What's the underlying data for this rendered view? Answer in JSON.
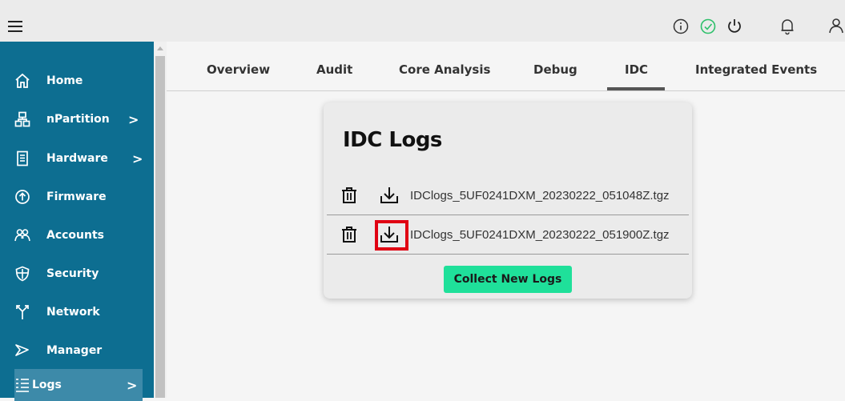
{
  "sidebar": {
    "items": [
      {
        "label": "Home",
        "icon": "home-icon",
        "has_chevron": false
      },
      {
        "label": "nPartition",
        "icon": "partition-icon",
        "has_chevron": true
      },
      {
        "label": "Hardware",
        "icon": "hardware-icon",
        "has_chevron": true
      },
      {
        "label": "Firmware",
        "icon": "firmware-icon",
        "has_chevron": false
      },
      {
        "label": "Accounts",
        "icon": "accounts-icon",
        "has_chevron": false
      },
      {
        "label": "Security",
        "icon": "shield-icon",
        "has_chevron": false
      },
      {
        "label": "Network",
        "icon": "network-icon",
        "has_chevron": false
      },
      {
        "label": "Manager",
        "icon": "manager-icon",
        "has_chevron": false
      },
      {
        "label": "Logs",
        "icon": "logs-icon",
        "has_chevron": true,
        "active": true
      }
    ],
    "chevron": ">"
  },
  "tabs": [
    {
      "label": "Overview"
    },
    {
      "label": "Audit"
    },
    {
      "label": "Core Analysis"
    },
    {
      "label": "Debug"
    },
    {
      "label": "IDC",
      "active": true
    },
    {
      "label": "Integrated Events"
    }
  ],
  "card": {
    "title": "IDC Logs",
    "logs": [
      {
        "filename": "IDClogs_5UF0241DXM_20230222_051048Z.tgz"
      },
      {
        "filename": "IDClogs_5UF0241DXM_20230222_051900Z.tgz",
        "highlighted": true
      }
    ],
    "collect_button": "Collect New Logs"
  },
  "colors": {
    "sidebar_bg": "#0d6e91",
    "accent_button": "#1fe09a",
    "status_ok": "#2ec06b",
    "highlight": "#e00012"
  }
}
